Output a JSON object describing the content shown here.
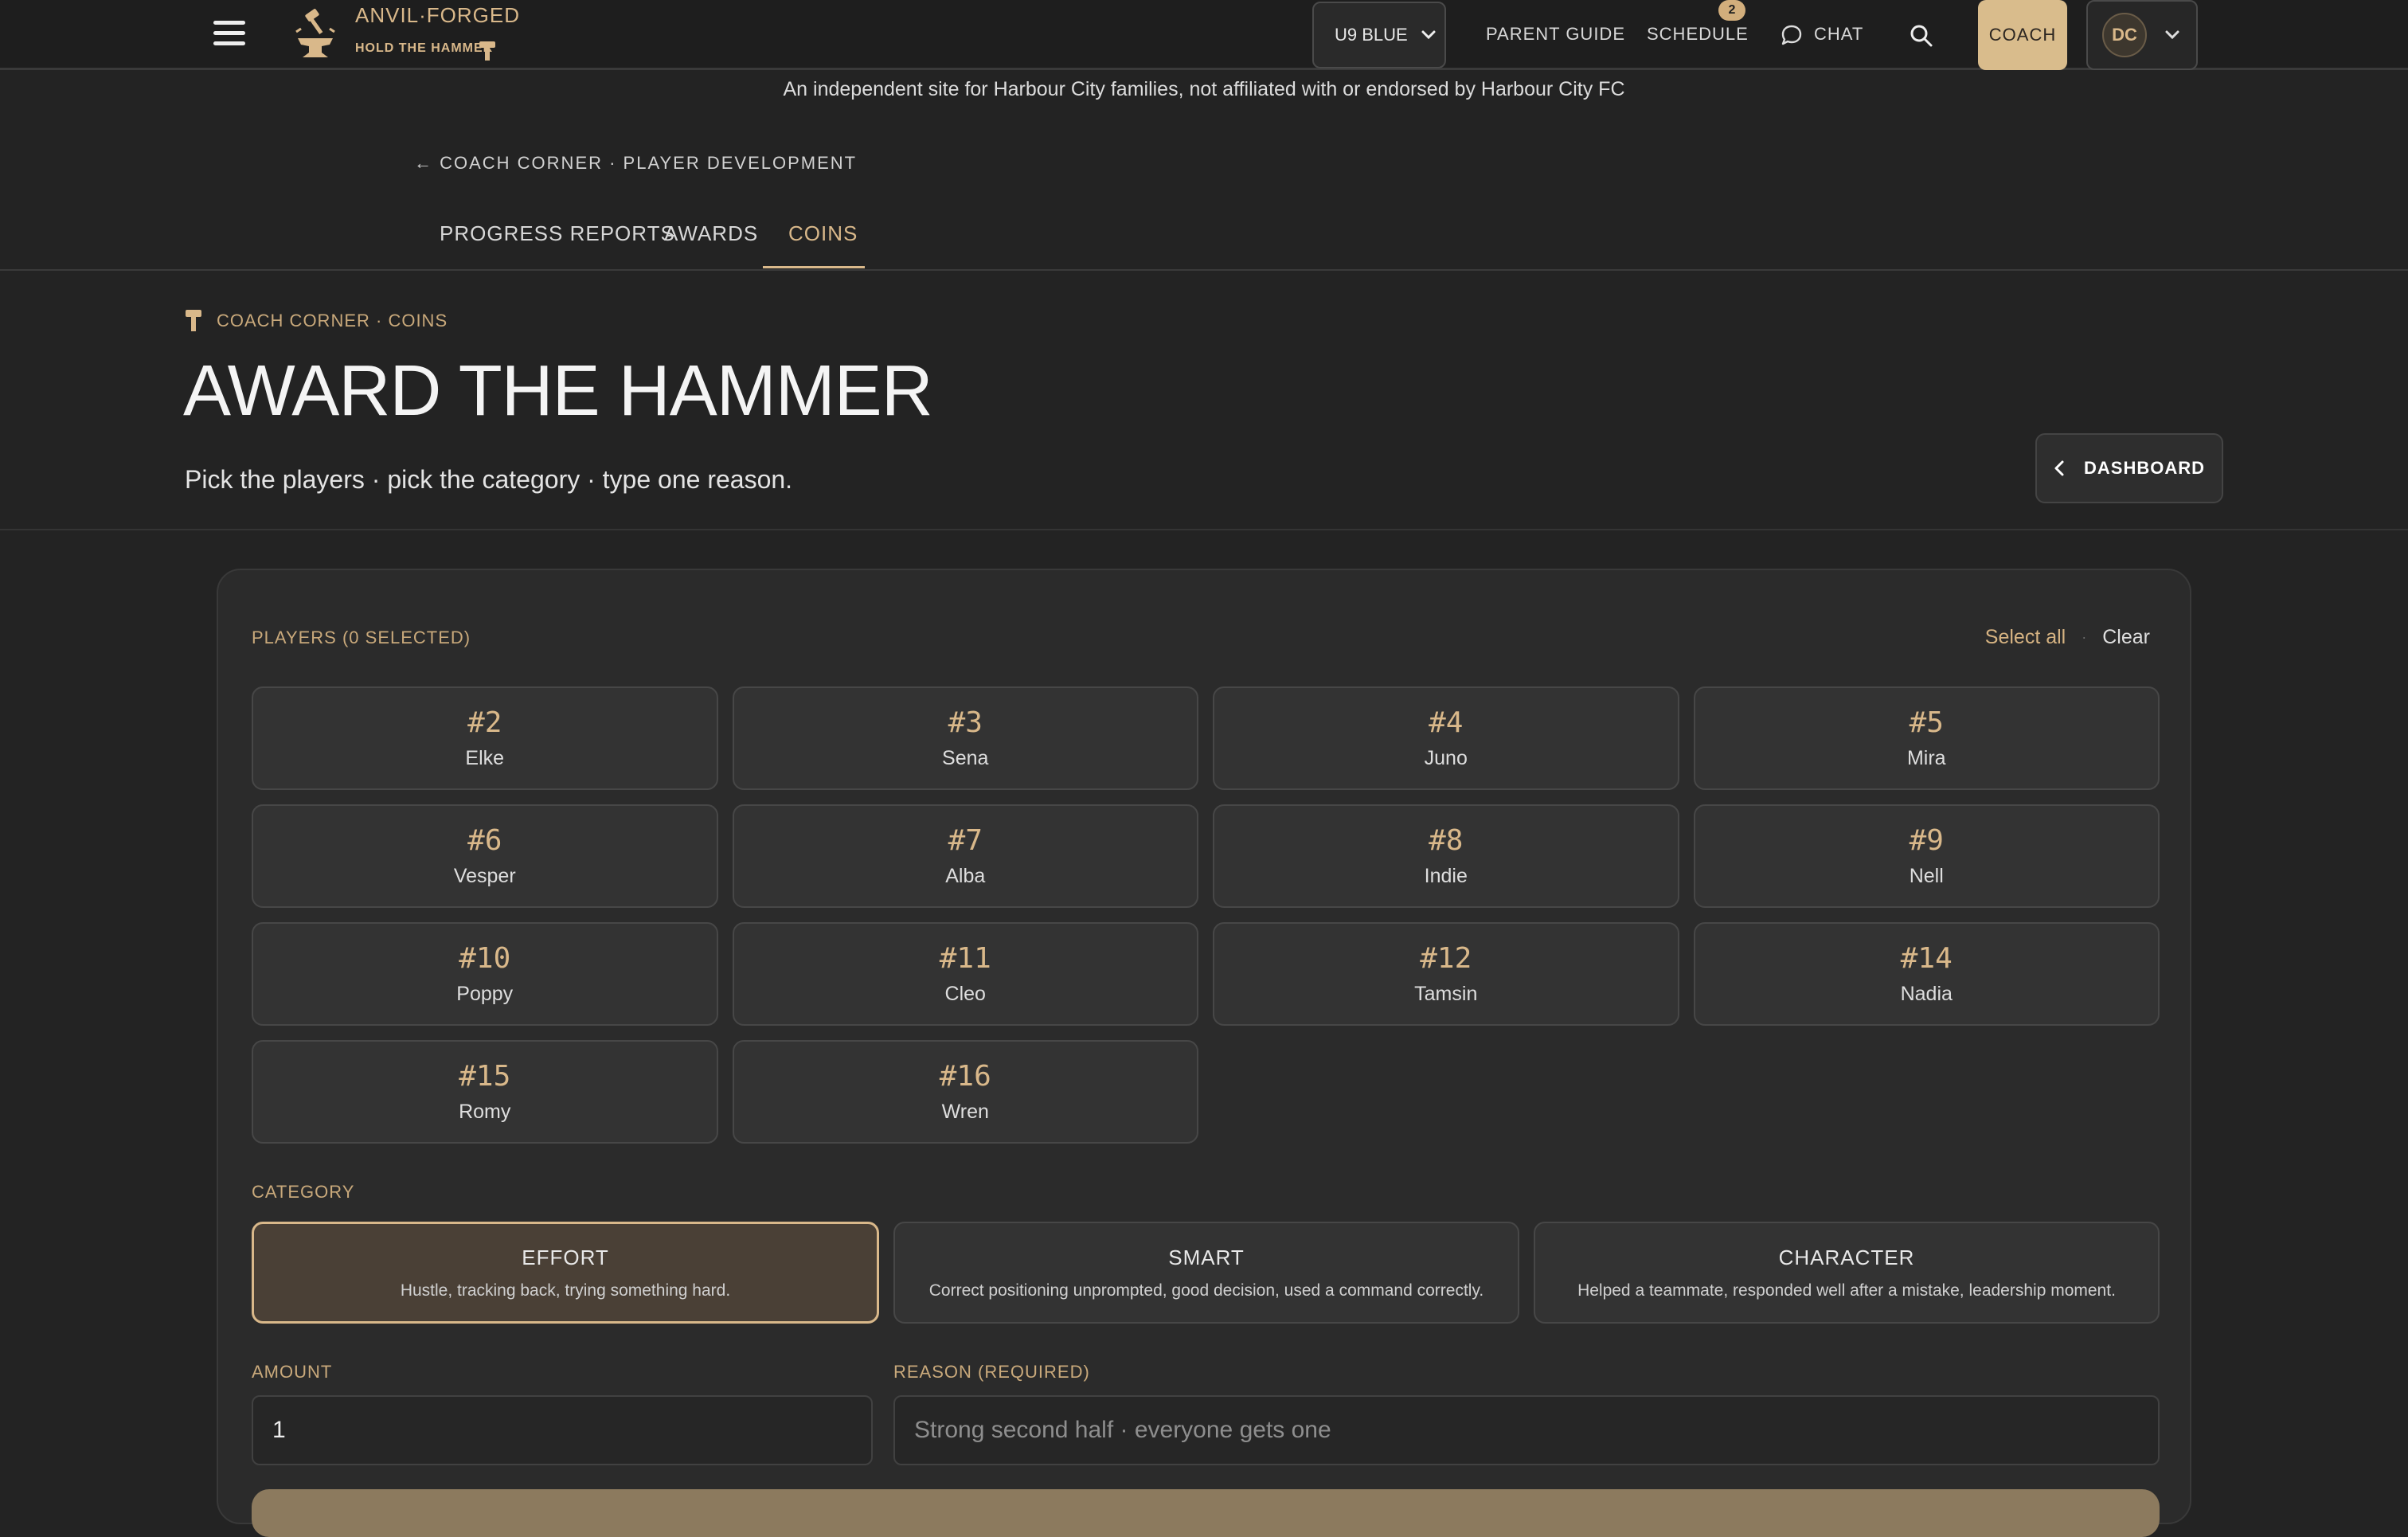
{
  "brand": {
    "name": "ANVIL·FORGED",
    "tagline": "HOLD THE HAMMER"
  },
  "nav": {
    "team_select": "U9 BLUE",
    "links": {
      "parent_guide": "PARENT GUIDE",
      "schedule": "SCHEDULE",
      "chat": "CHAT"
    },
    "schedule_badge": "2",
    "coach_button": "COACH",
    "user_initials": "DC"
  },
  "disclaimer": "An independent site for Harbour City families, not affiliated with or endorsed by Harbour City FC",
  "breadcrumb": "← COACH CORNER · PLAYER DEVELOPMENT",
  "tabs": [
    {
      "label": "PROGRESS REPORTS",
      "active": false
    },
    {
      "label": "AWARDS",
      "active": false
    },
    {
      "label": "COINS",
      "active": true
    }
  ],
  "header": {
    "eyebrow": "COACH CORNER · COINS",
    "title": "AWARD THE HAMMER",
    "subtitle": "Pick the players · pick the category · type one reason.",
    "dashboard_button": "DASHBOARD"
  },
  "players_section": {
    "label": "PLAYERS (0 SELECTED)",
    "select_all": "Select all",
    "separator": "·",
    "clear": "Clear",
    "players": [
      {
        "number": "#2",
        "name": "Elke"
      },
      {
        "number": "#3",
        "name": "Sena"
      },
      {
        "number": "#4",
        "name": "Juno"
      },
      {
        "number": "#5",
        "name": "Mira"
      },
      {
        "number": "#6",
        "name": "Vesper"
      },
      {
        "number": "#7",
        "name": "Alba"
      },
      {
        "number": "#8",
        "name": "Indie"
      },
      {
        "number": "#9",
        "name": "Nell"
      },
      {
        "number": "#10",
        "name": "Poppy"
      },
      {
        "number": "#11",
        "name": "Cleo"
      },
      {
        "number": "#12",
        "name": "Tamsin"
      },
      {
        "number": "#14",
        "name": "Nadia"
      },
      {
        "number": "#15",
        "name": "Romy"
      },
      {
        "number": "#16",
        "name": "Wren"
      }
    ]
  },
  "category_section": {
    "label": "CATEGORY",
    "categories": [
      {
        "title": "EFFORT",
        "description": "Hustle, tracking back, trying something hard.",
        "selected": true
      },
      {
        "title": "SMART",
        "description": "Correct positioning unprompted, good decision, used a command correctly.",
        "selected": false
      },
      {
        "title": "CHARACTER",
        "description": "Helped a teammate, responded well after a mistake, leadership moment.",
        "selected": false
      }
    ]
  },
  "amount": {
    "label": "AMOUNT",
    "value": "1"
  },
  "reason": {
    "label": "REASON (REQUIRED)",
    "placeholder": "Strong second half · everyone gets one"
  },
  "colors": {
    "accent": "#d9b88a",
    "background": "#232323",
    "card": "#2b2b2b",
    "selected_category_bg": "#4a4036"
  }
}
